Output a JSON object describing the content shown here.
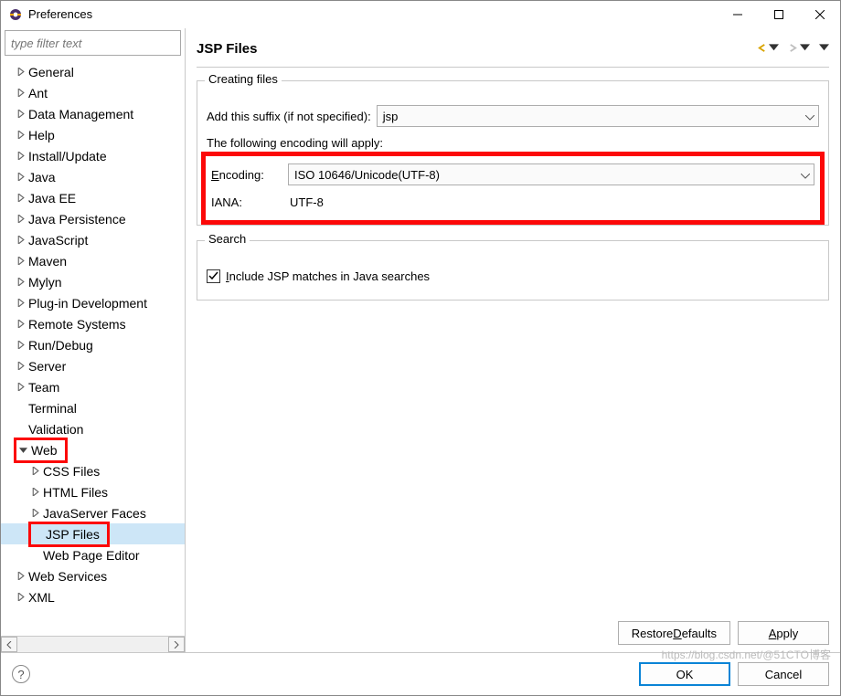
{
  "title": "Preferences",
  "filter_placeholder": "type filter text",
  "tree": {
    "items": [
      {
        "label": "General",
        "depth": 0,
        "expand": "closed"
      },
      {
        "label": "Ant",
        "depth": 0,
        "expand": "closed"
      },
      {
        "label": "Data Management",
        "depth": 0,
        "expand": "closed"
      },
      {
        "label": "Help",
        "depth": 0,
        "expand": "closed"
      },
      {
        "label": "Install/Update",
        "depth": 0,
        "expand": "closed"
      },
      {
        "label": "Java",
        "depth": 0,
        "expand": "closed"
      },
      {
        "label": "Java EE",
        "depth": 0,
        "expand": "closed"
      },
      {
        "label": "Java Persistence",
        "depth": 0,
        "expand": "closed"
      },
      {
        "label": "JavaScript",
        "depth": 0,
        "expand": "closed"
      },
      {
        "label": "Maven",
        "depth": 0,
        "expand": "closed"
      },
      {
        "label": "Mylyn",
        "depth": 0,
        "expand": "closed"
      },
      {
        "label": "Plug-in Development",
        "depth": 0,
        "expand": "closed"
      },
      {
        "label": "Remote Systems",
        "depth": 0,
        "expand": "closed"
      },
      {
        "label": "Run/Debug",
        "depth": 0,
        "expand": "closed"
      },
      {
        "label": "Server",
        "depth": 0,
        "expand": "closed"
      },
      {
        "label": "Team",
        "depth": 0,
        "expand": "closed"
      },
      {
        "label": "Terminal",
        "depth": 0,
        "expand": "none"
      },
      {
        "label": "Validation",
        "depth": 0,
        "expand": "none"
      },
      {
        "label": "Web",
        "depth": 0,
        "expand": "open",
        "highlight": true
      },
      {
        "label": "CSS Files",
        "depth": 1,
        "expand": "closed"
      },
      {
        "label": "HTML Files",
        "depth": 1,
        "expand": "closed"
      },
      {
        "label": "JavaServer Faces",
        "depth": 1,
        "expand": "closed"
      },
      {
        "label": "JSP Files",
        "depth": 1,
        "expand": "none",
        "selected": true,
        "highlight": true
      },
      {
        "label": "Web Page Editor",
        "depth": 1,
        "expand": "none"
      },
      {
        "label": "Web Services",
        "depth": 0,
        "expand": "closed"
      },
      {
        "label": "XML",
        "depth": 0,
        "expand": "closed"
      }
    ]
  },
  "page": {
    "heading": "JSP Files",
    "group_creating": {
      "title": "Creating files",
      "suffix_label": "Add this suffix (if not specified):",
      "suffix_value": "jsp",
      "following_text": "The following encoding will apply:",
      "encoding_label": "Encoding:",
      "encoding_value": "ISO 10646/Unicode(UTF-8)",
      "iana_label": "IANA:",
      "iana_value": "UTF-8"
    },
    "group_search": {
      "title": "Search",
      "checkbox_label": "Include JSP matches in Java searches",
      "checked": true
    },
    "restore_btn": "Restore Defaults",
    "apply_btn": "Apply"
  },
  "footer": {
    "ok": "OK",
    "cancel": "Cancel"
  },
  "watermark": "https://blog.csdn.net/@51CTO博客"
}
